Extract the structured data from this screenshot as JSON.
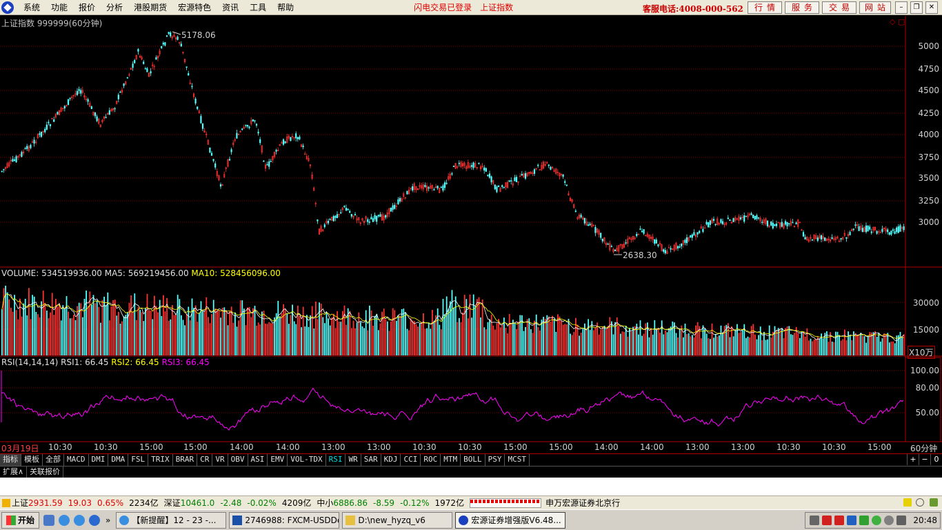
{
  "menu": {
    "items": [
      "系统",
      "功能",
      "报价",
      "分析",
      "港股期货",
      "宏源特色",
      "资讯",
      "工具",
      "帮助"
    ],
    "notice1": "闪电交易已登录",
    "notice2": "上证指数",
    "hotline": "客服电话:4008-000-562",
    "quick_buttons": [
      "行情",
      "服务",
      "交易",
      "网站"
    ]
  },
  "price_panel": {
    "title": "上证指数 999999(60分钟)",
    "high_label": "5178.06",
    "low_label": "2638.30",
    "yticks": [
      "5000",
      "4750",
      "4500",
      "4250",
      "4000",
      "3750",
      "3500",
      "3250",
      "3000"
    ]
  },
  "volume_panel": {
    "label": "VOLUME: 534519936.00",
    "ma5": "MA5: 569219456.00",
    "ma10": "MA10: 528456096.00",
    "yticks": [
      "30000",
      "15000"
    ],
    "unit": "X10万"
  },
  "rsi_panel": {
    "label": "RSI(14,14,14)",
    "rsi1": "RSI1: 66.45",
    "rsi2": "RSI2: 66.45",
    "rsi3": "RSI3: 66.45",
    "yticks": [
      "100.00",
      "80.00",
      "50.00"
    ]
  },
  "time_axis": {
    "labels": [
      "03月19日",
      "10:30",
      "10:30",
      "15:00",
      "15:00",
      "14:00",
      "14:00",
      "13:00",
      "13:00",
      "10:30",
      "10:30",
      "15:00",
      "15:00",
      "14:00",
      "14:00",
      "13:00",
      "13:00",
      "10:30",
      "10:30",
      "15:00"
    ],
    "period": "60分钟"
  },
  "indicator_tabs": [
    "指标",
    "模板",
    "全部",
    "MACD",
    "DMI",
    "DMA",
    "FSL",
    "TRIX",
    "BRAR",
    "CR",
    "VR",
    "OBV",
    "ASI",
    "EMV",
    "VOL-TDX",
    "RSI",
    "WR",
    "SAR",
    "KDJ",
    "CCI",
    "ROC",
    "MTM",
    "BOLL",
    "PSY",
    "MCST"
  ],
  "active_tab": "RSI",
  "ext_tabs": [
    "扩展∧",
    "关联报价"
  ],
  "status": {
    "sh_name": "上证",
    "sh_value": "2931.59",
    "sh_change": "19.03",
    "sh_pct": "0.65%",
    "sh_amount": "2234亿",
    "sz_name": "深证",
    "sz_value": "10461.0",
    "sz_change": "-2.48",
    "sz_pct": "-0.02%",
    "sz_amount": "4209亿",
    "zx_name": "中小",
    "zx_value": "6886.86",
    "zx_change": "-8.59",
    "zx_pct": "-0.12%",
    "zx_amount": "1972亿",
    "broker": "申万宏源证券北京行"
  },
  "taskbar": {
    "start": "开始",
    "tasks": [
      "【新提醒】12 - 23 -...",
      "2746988: FXCM-USDDe...",
      "D:\\new_hyzq_v6",
      "宏源证券增强版V6.48..."
    ],
    "clock": "20:48"
  },
  "colors": {
    "up": "#ff3232",
    "down": "#54ffff",
    "ma5": "#ffffff",
    "ma10": "#ffff00",
    "rsi": "#ff00ff",
    "grid": "#800000"
  }
}
